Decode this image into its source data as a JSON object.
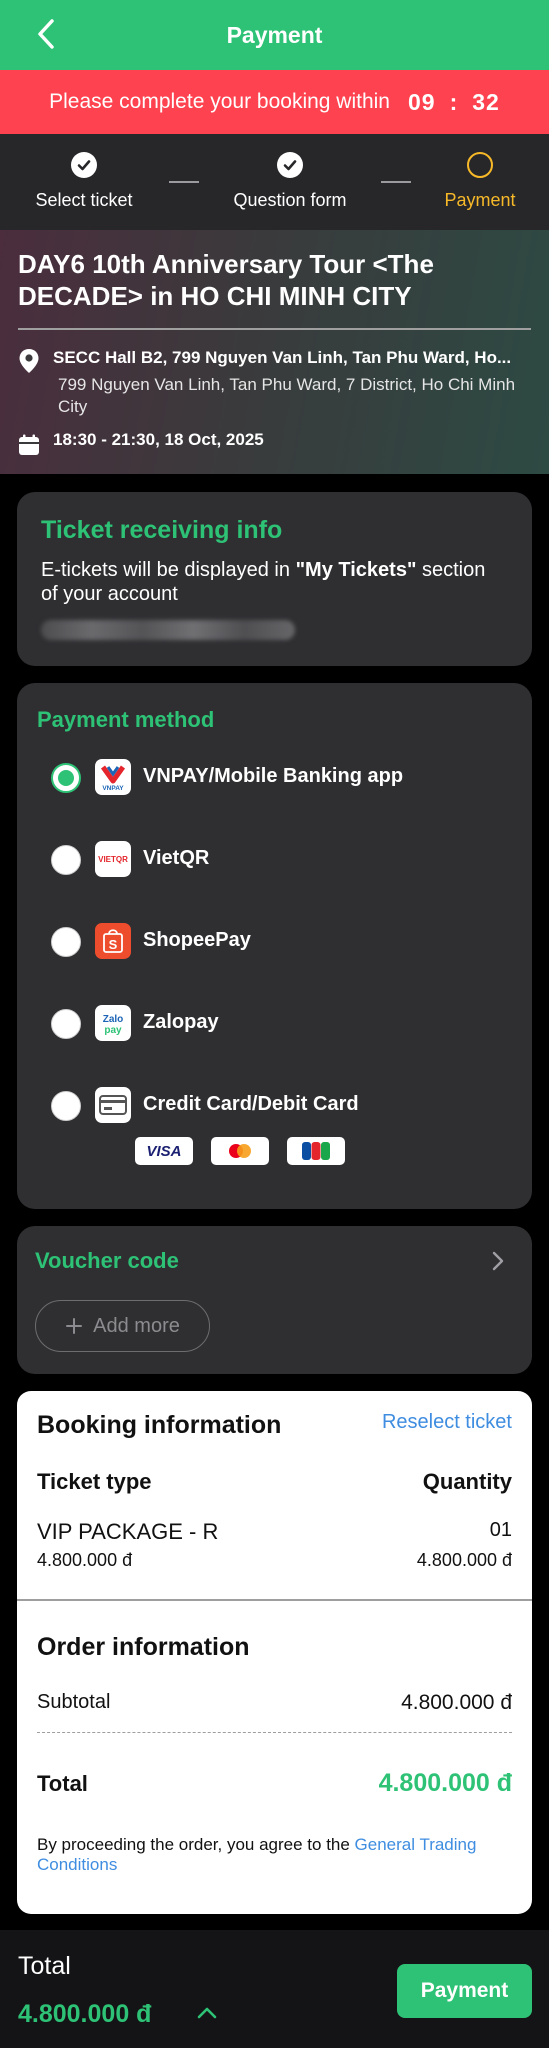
{
  "header": {
    "title": "Payment"
  },
  "timer": {
    "message": "Please complete your booking within",
    "minutes": "09",
    "separator": ":",
    "seconds": "32"
  },
  "steps": [
    {
      "label": "Select ticket",
      "state": "done"
    },
    {
      "label": "Question form",
      "state": "done"
    },
    {
      "label": "Payment",
      "state": "active"
    }
  ],
  "event": {
    "name": "DAY6 10th Anniversary Tour <The DECADE> in HO CHI MINH CITY",
    "venue": "SECC Hall B2, 799 Nguyen Van Linh, Tan Phu Ward, Ho...",
    "address": "799 Nguyen Van Linh, Tan Phu Ward, 7 District, Ho Chi Minh City",
    "datetime": "18:30 - 21:30, 18 Oct, 2025"
  },
  "ticket_info": {
    "title": "Ticket receiving info",
    "desc_prefix": "E-tickets will be displayed in ",
    "desc_bold": "\"My Tickets\"",
    "desc_suffix": " section of your account"
  },
  "payment_method": {
    "title": "Payment method",
    "options": [
      {
        "label": "VNPAY/Mobile Banking app",
        "icon": "vnpay-icon",
        "selected": true
      },
      {
        "label": "VietQR",
        "icon": "vietqr-icon",
        "selected": false
      },
      {
        "label": "ShopeePay",
        "icon": "shopeepay-icon",
        "selected": false
      },
      {
        "label": "Zalopay",
        "icon": "zalopay-icon",
        "selected": false
      },
      {
        "label": "Credit Card/Debit Card",
        "icon": "credit-card-icon",
        "selected": false
      }
    ],
    "logo_texts": {
      "vnpay": "VNPAY",
      "vietqr": "VIETQR",
      "shopee": "S",
      "zalo_top": "Zalo",
      "zalo_bottom": "pay"
    },
    "card_brands": [
      "VISA",
      "mastercard",
      "JCB"
    ]
  },
  "voucher": {
    "title": "Voucher code",
    "add_label": "Add more"
  },
  "booking": {
    "title": "Booking information",
    "reselect_label": "Reselect ticket",
    "ticket_type_header": "Ticket type",
    "quantity_header": "Quantity",
    "ticket_name": "VIP PACKAGE - R",
    "ticket_qty": "01",
    "ticket_price": "4.800.000 đ",
    "ticket_line_total": "4.800.000 đ"
  },
  "order": {
    "title": "Order information",
    "subtotal_label": "Subtotal",
    "subtotal_value": "4.800.000 đ",
    "total_label": "Total",
    "total_value": "4.800.000 đ",
    "terms_prefix": "By proceeding the order, you agree to the ",
    "terms_link": "General Trading Conditions"
  },
  "footer": {
    "total_label": "Total",
    "total_value": "4.800.000 đ",
    "pay_label": "Payment"
  },
  "colors": {
    "accent": "#2dc275",
    "timer_bg": "#ff424f",
    "step_active": "#f7b928",
    "link": "#3f8de0"
  }
}
